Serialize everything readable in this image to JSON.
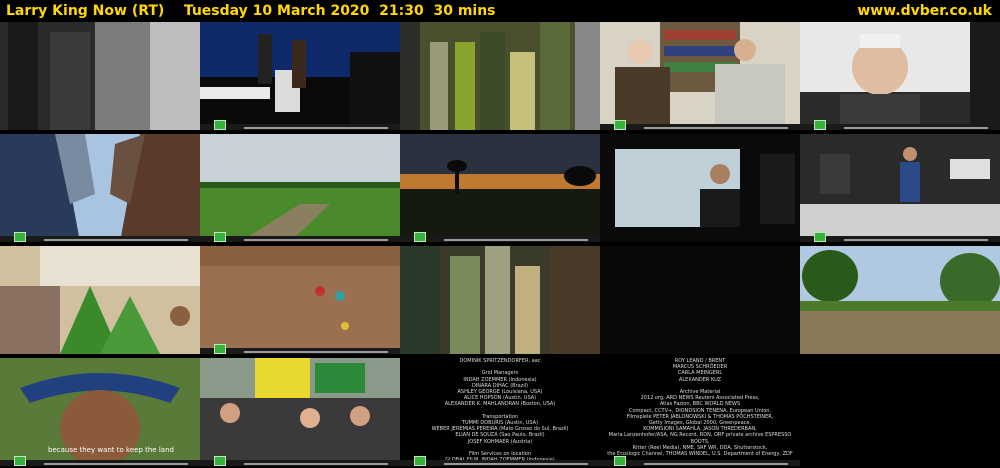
{
  "header": {
    "title": "Larry King Now (RT)    Tuesday 10 March 2020  21:30  30 mins",
    "site": "www.dvber.co.uk"
  },
  "thumbnails": [
    {
      "row": 1,
      "col": 1,
      "scene": "blurred vertical stripes"
    },
    {
      "row": 1,
      "col": 2,
      "scene": "speaker at podium on stage"
    },
    {
      "row": 1,
      "col": 3,
      "scene": "blurred vertical stripes"
    },
    {
      "row": 1,
      "col": 4,
      "scene": "two men talking in library"
    },
    {
      "row": 1,
      "col": 5,
      "scene": "older man speaking close-up"
    },
    {
      "row": 2,
      "col": 1,
      "scene": "skyscrapers looking up"
    },
    {
      "row": 2,
      "col": 2,
      "scene": "green field with road"
    },
    {
      "row": 2,
      "col": 3,
      "scene": "sunset over plains"
    },
    {
      "row": 2,
      "col": 4,
      "scene": "video screen in dark room"
    },
    {
      "row": 2,
      "col": 5,
      "scene": "man in office with screens"
    },
    {
      "row": 3,
      "col": 1,
      "scene": "man with plant leaves, sign behind"
    },
    {
      "row": 3,
      "col": 2,
      "scene": "people in muddy river"
    },
    {
      "row": 3,
      "col": 3,
      "scene": "blurred vertical stripes"
    },
    {
      "row": 3,
      "col": 4,
      "scene": "dark frame"
    },
    {
      "row": 3,
      "col": 5,
      "scene": "flooded field with trees"
    },
    {
      "row": 4,
      "col": 1,
      "scene": "indigenous man with feather headdress",
      "subtitle": "because they want to keep the land"
    },
    {
      "row": 4,
      "col": 2,
      "scene": "protest crowd with banners"
    },
    {
      "row": 4,
      "col": 3,
      "scene": "end credits",
      "credits": [
        "DOMINIK SPRITZENDORFER, aac",
        "",
        "Grid Managers",
        "INDAH ZOEMMER (Indonesia)",
        "DINARA DIHAC (Brazil)",
        "ASHLEY GEORGE (Louisiana, USA)",
        "ALICE HOPSON (Austin, USA)",
        "ALEXANDER K. MAHLANDRAN (Boston, USA)",
        "",
        "Transportation",
        "TUMMI DOBURIS (Austin, USA)",
        "WEBER JEREMIAS PEREIRA (Mato Grosso do Sul, Brazil)",
        "ELIAN DE SOUZA (Sao Paulo, Brazil)",
        "JOSEF KOHMAER (Austria)",
        "",
        "Film Services on location",
        "GLOBAL FILM, INDAH ZOEMMER (Indonesia)"
      ]
    },
    {
      "row": 4,
      "col": 4,
      "scene": "end credits",
      "credits": [
        "ROY LEAND / BRENT",
        "MARCUS SCHRÖEDER",
        "CARLA MEINGERL",
        "ALEXANDER KUZ",
        "",
        "Archive Material",
        "2012 org, ARD NEWS Reuters Associated Press,",
        "Atlas Fazion, BBC WORLD NEWS",
        "Compact, CCTV+, DIONDSION TENENA, European Union,",
        "Filmspiele PETER JABLONOWSKI & THOMAS PÖCHSTEINER,",
        "Getty Images, Global 2000, Greenpeace,",
        "KOMMISIONI SAMAHLA, JASON THREDERBAN,",
        "Maria Lanzenhofer/ASA, NG Record, RDN, ORF private archive ESPRESSO BOOTS,",
        "Ritter (Reel Media), NME, SRF WR, DDA, Shutterstock,",
        "the Ecoslogic Channel, THOMAS WINDEL, U.S. Department of Energy, ZDF"
      ]
    }
  ]
}
